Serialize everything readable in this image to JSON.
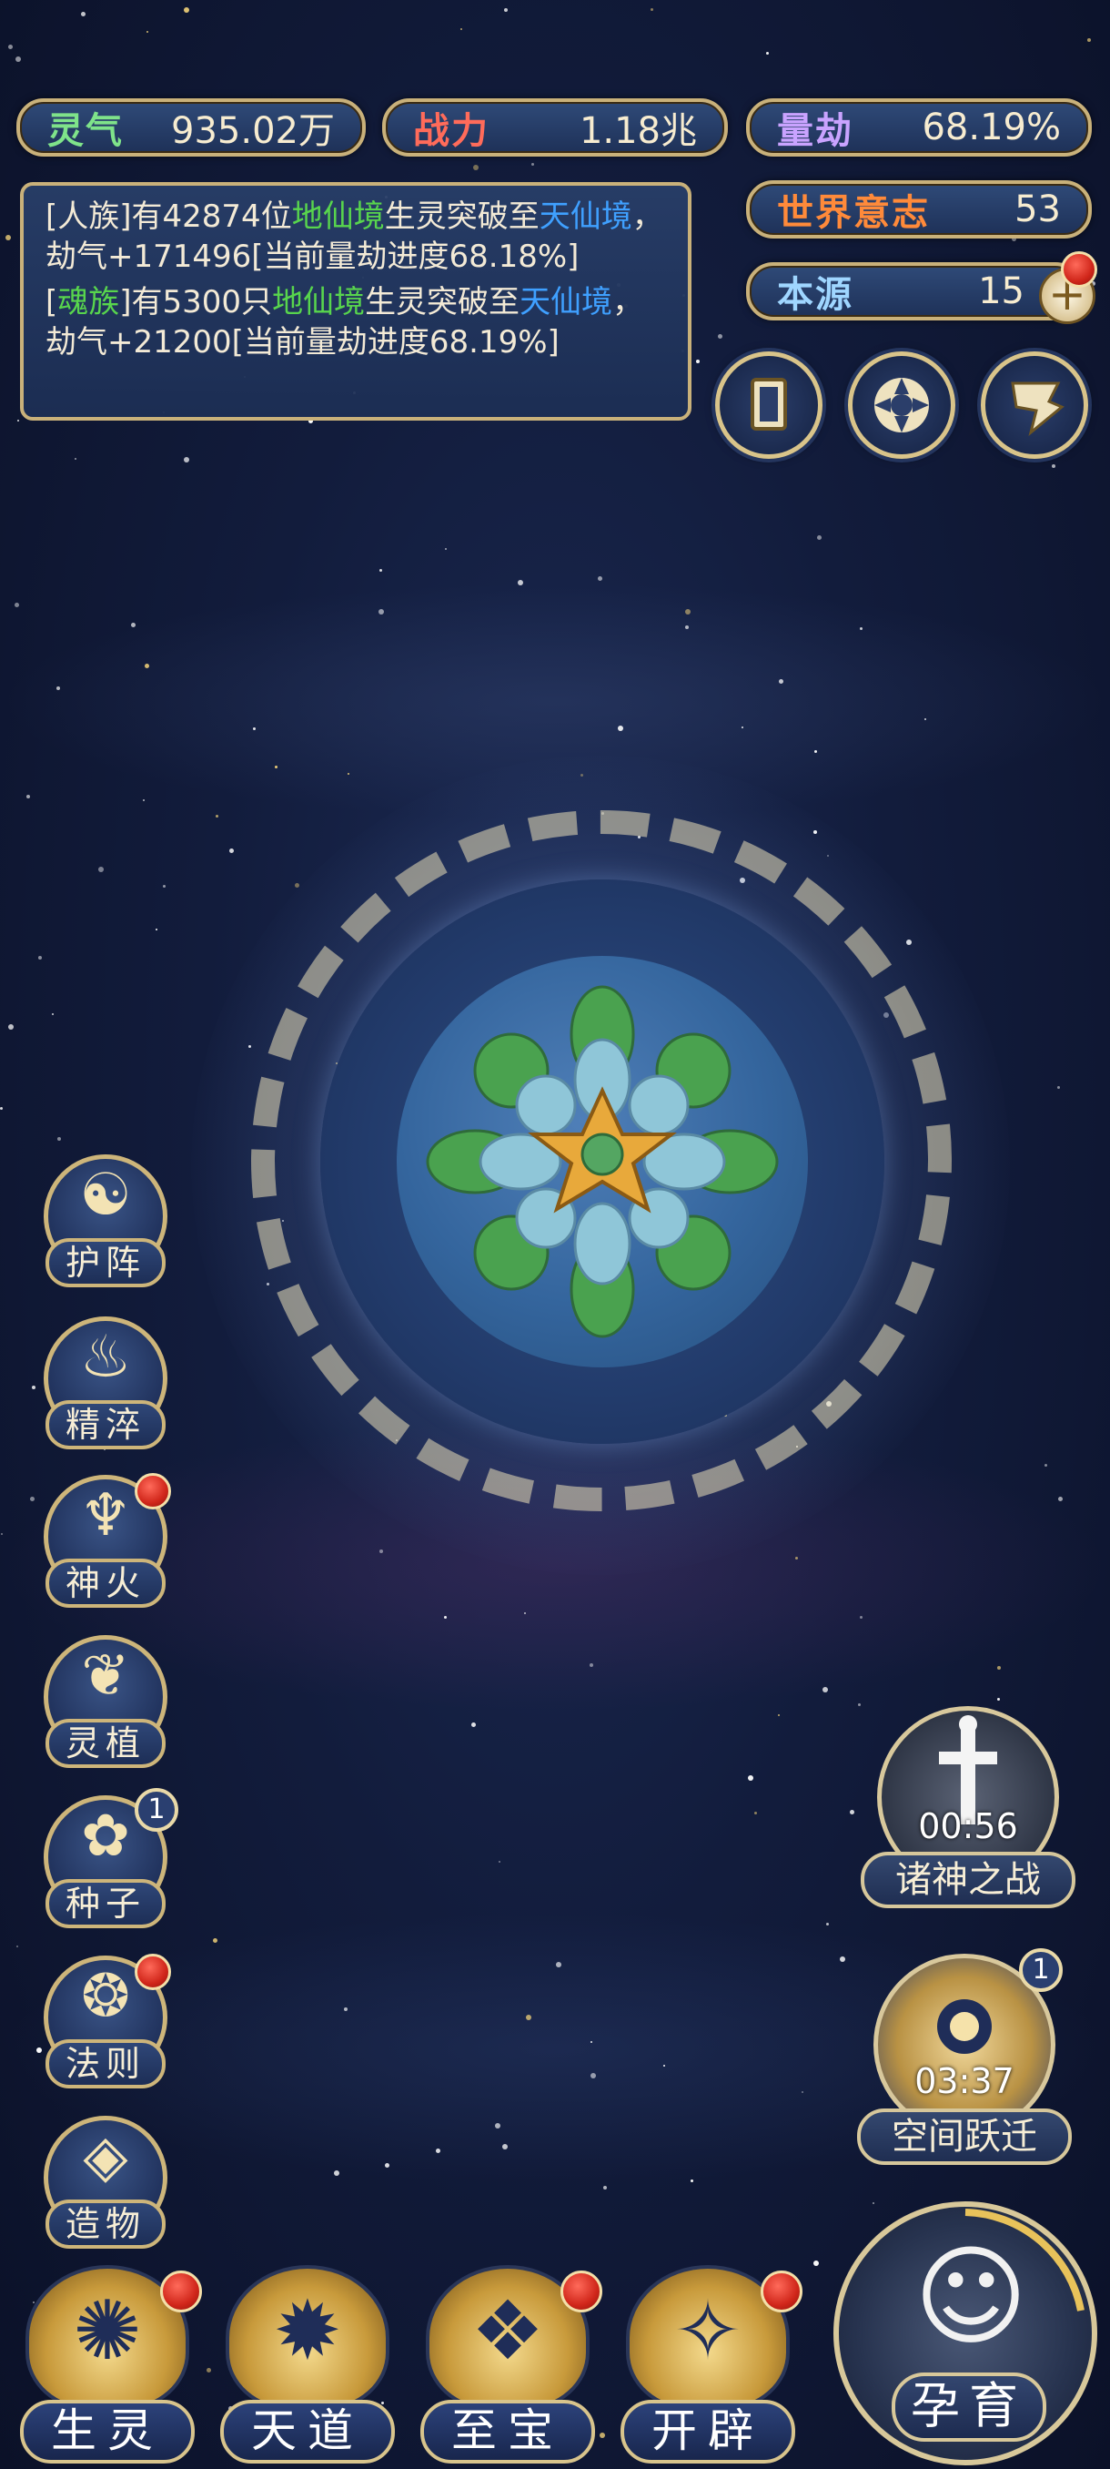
{
  "stats": {
    "lingqi": {
      "label": "灵气",
      "value": "935.02万"
    },
    "zhanli": {
      "label": "战力",
      "value": "1.18兆"
    },
    "liangjie": {
      "label": "量劫",
      "value": "68.19%"
    },
    "world_will": {
      "label": "世界意志",
      "value": "53"
    },
    "benyuan": {
      "label": "本源",
      "value": "15",
      "plus": "+"
    }
  },
  "log": {
    "entry1": {
      "prefix": "[人族]有42874位",
      "realm_from": "地仙境",
      "mid": "生灵突破至",
      "realm_to": "天仙境",
      "suffix": "，劫气+171496[当前量劫进度68.18%]"
    },
    "entry2": {
      "prefix_bracket_open": "[",
      "race": "魂族",
      "prefix_rest": "]有5300只",
      "realm_from": "地仙境",
      "mid": "生灵突破至",
      "realm_to": "天仙境",
      "suffix": "，劫气+21200[当前量劫进度68.19%]"
    }
  },
  "top_icons": [
    "card-icon",
    "vortex-icon",
    "flag-icon"
  ],
  "side_buttons": [
    {
      "label": "护阵",
      "glyph": "☯"
    },
    {
      "label": "精淬",
      "glyph": "♨"
    },
    {
      "label": "神火",
      "glyph": "♆"
    },
    {
      "label": "灵植",
      "glyph": "❦"
    },
    {
      "label": "种子",
      "glyph": "✿",
      "badge": "1"
    },
    {
      "label": "法则",
      "glyph": "❂"
    },
    {
      "label": "造物",
      "glyph": "◈"
    }
  ],
  "events": {
    "gods_war": {
      "label": "诸神之战",
      "timer": "00:56"
    },
    "space_jump": {
      "label": "空间跃迁",
      "timer": "03:37",
      "badge": "1"
    }
  },
  "bottom_nav": [
    {
      "label": "生灵",
      "glyph": "✺"
    },
    {
      "label": "天道",
      "glyph": "✹"
    },
    {
      "label": "至宝",
      "glyph": "❖"
    },
    {
      "label": "开辟",
      "glyph": "✧"
    }
  ],
  "breed_button": {
    "label": "孕育"
  },
  "colors": {
    "gold_border": "#c9b17a",
    "realm_green": "#58d54d",
    "realm_blue": "#3fa0ff",
    "red_dot": "#d0261a"
  }
}
